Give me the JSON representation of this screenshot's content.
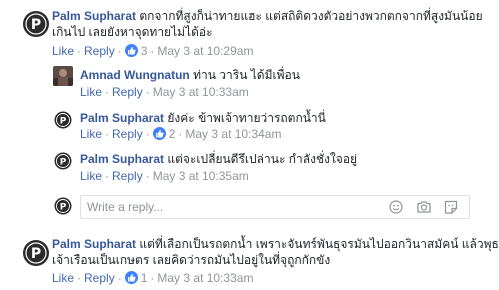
{
  "labels": {
    "like": "Like",
    "reply": "Reply",
    "dot": "·"
  },
  "comments": [
    {
      "author": "Palm Supharat",
      "text_line1": "ตกจากที่สูงก็น่าทายแฮะ แต่สถิติดวงตัวอย่างพวกตกจากที่สูงมันน้อย",
      "text_line2": "เกินไป เลยยังหาจุดทายไม่ได้อ่ะ",
      "like_count": "3",
      "time": "May 3 at 10:29am"
    }
  ],
  "replies": [
    {
      "author": "Amnad Wungnatun",
      "text": "ท่าน วาริน ได้มีเพื่อน",
      "like_count": "",
      "time": "May 3 at 10:33am"
    },
    {
      "author": "Palm Supharat",
      "text": "ยังค่ะ ข้าพเจ้าทายว่ารถตกน้ำนี่",
      "like_count": "2",
      "time": "May 3 at 10:34am"
    },
    {
      "author": "Palm Supharat",
      "text": "แต่จะเปลี่ยนดีรึเปล่านะ กำลังชั่งใจอยู่",
      "like_count": "",
      "time": "May 3 at 10:35am"
    }
  ],
  "reply_box": {
    "placeholder": "Write a reply..."
  },
  "comment2": {
    "author": "Palm Supharat",
    "text_line1": "แต่ที่เลือกเป็นรถตกน้ำ เพราะจันทร์พันธุจรมันไปออกวินาสมัคน์ แล้วพุธ",
    "text_line2": "เจ้าเรือนเป็นเกษตร เลยคิดว่ารถมันไปอยู่ในที่จุถูกกักขัง",
    "like_count": "1",
    "time": "May 3 at 10:33am"
  },
  "icons": {
    "avatar": "palm-avatar-icon",
    "like_badge": "thumbs-up-icon",
    "emoji": "smiley-icon",
    "camera": "camera-icon",
    "gif": "gif-icon",
    "sticker": "sticker-icon"
  },
  "colors": {
    "author": "#365899",
    "link": "#4267b2",
    "meta": "#90949c",
    "like_badge": "#4080ff"
  }
}
